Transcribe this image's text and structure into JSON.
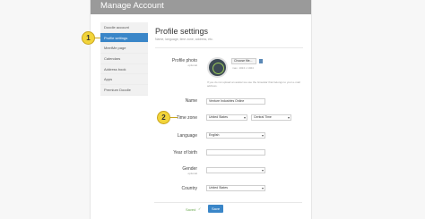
{
  "app": {
    "title": "Manage Account"
  },
  "sidebar": {
    "items": [
      {
        "label": "Doodle account"
      },
      {
        "label": "Profile settings"
      },
      {
        "label": "MeetMe page"
      },
      {
        "label": "Calendars"
      },
      {
        "label": "Address book"
      },
      {
        "label": "Apps"
      },
      {
        "label": "Premium Doodle"
      }
    ]
  },
  "callouts": {
    "one": "1",
    "two": "2"
  },
  "main": {
    "heading": "Profile settings",
    "subheading": "Name, language, time zone, address, etc."
  },
  "photo": {
    "label": "Profile photo",
    "sublabel": "optional",
    "choose_label": "Choose file...",
    "size_hint": "max. 1024 x 1024",
    "help": "If you do not upload an avatar we use the Gravatar that belongs to your e-mail address."
  },
  "name": {
    "label": "Name",
    "value": "Venture Industries Online"
  },
  "timezone": {
    "label": "Time zone",
    "region": "United States",
    "zone": "Central Time"
  },
  "language": {
    "label": "Language",
    "value": "English"
  },
  "birth": {
    "label": "Year of birth",
    "value": ""
  },
  "gender": {
    "label": "Gender",
    "sublabel": "optional",
    "value": ""
  },
  "country": {
    "label": "Country",
    "value": "United States"
  },
  "footer": {
    "saved_label": "Saved",
    "save_label": "Save"
  },
  "colors": {
    "accent": "#3a86c8",
    "callout": "#f2d43a",
    "topbar": "#9a9a9a",
    "success": "#6aa84f"
  }
}
